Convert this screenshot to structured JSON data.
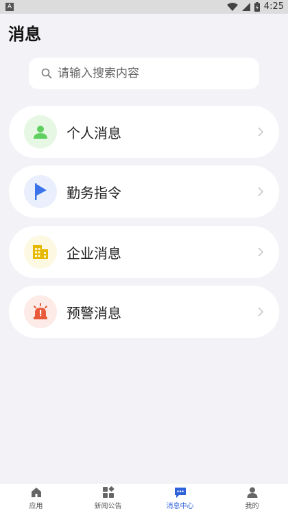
{
  "status": {
    "time": "4:25",
    "notif_label": "A"
  },
  "page": {
    "title": "消息"
  },
  "search": {
    "placeholder": "请输入搜索内容"
  },
  "items": [
    {
      "label": "个人消息",
      "icon": "person-icon",
      "bg": "#e6f7e3",
      "color": "#5fcf5f"
    },
    {
      "label": "勤务指令",
      "icon": "flag-icon",
      "bg": "#e9effc",
      "color": "#3a74e8"
    },
    {
      "label": "企业消息",
      "icon": "building-icon",
      "bg": "#fdf8e2",
      "color": "#e6b800"
    },
    {
      "label": "预警消息",
      "icon": "alarm-icon",
      "bg": "#fcebe6",
      "color": "#e85a3a"
    }
  ],
  "tabs": [
    {
      "label": "应用",
      "icon": "home-icon",
      "active": false
    },
    {
      "label": "新闻公告",
      "icon": "grid-icon",
      "active": false
    },
    {
      "label": "消息中心",
      "icon": "chat-icon",
      "active": true
    },
    {
      "label": "我的",
      "icon": "user-icon",
      "active": false
    }
  ],
  "colors": {
    "accent": "#2f62d8",
    "background": "#f3f3f7"
  }
}
